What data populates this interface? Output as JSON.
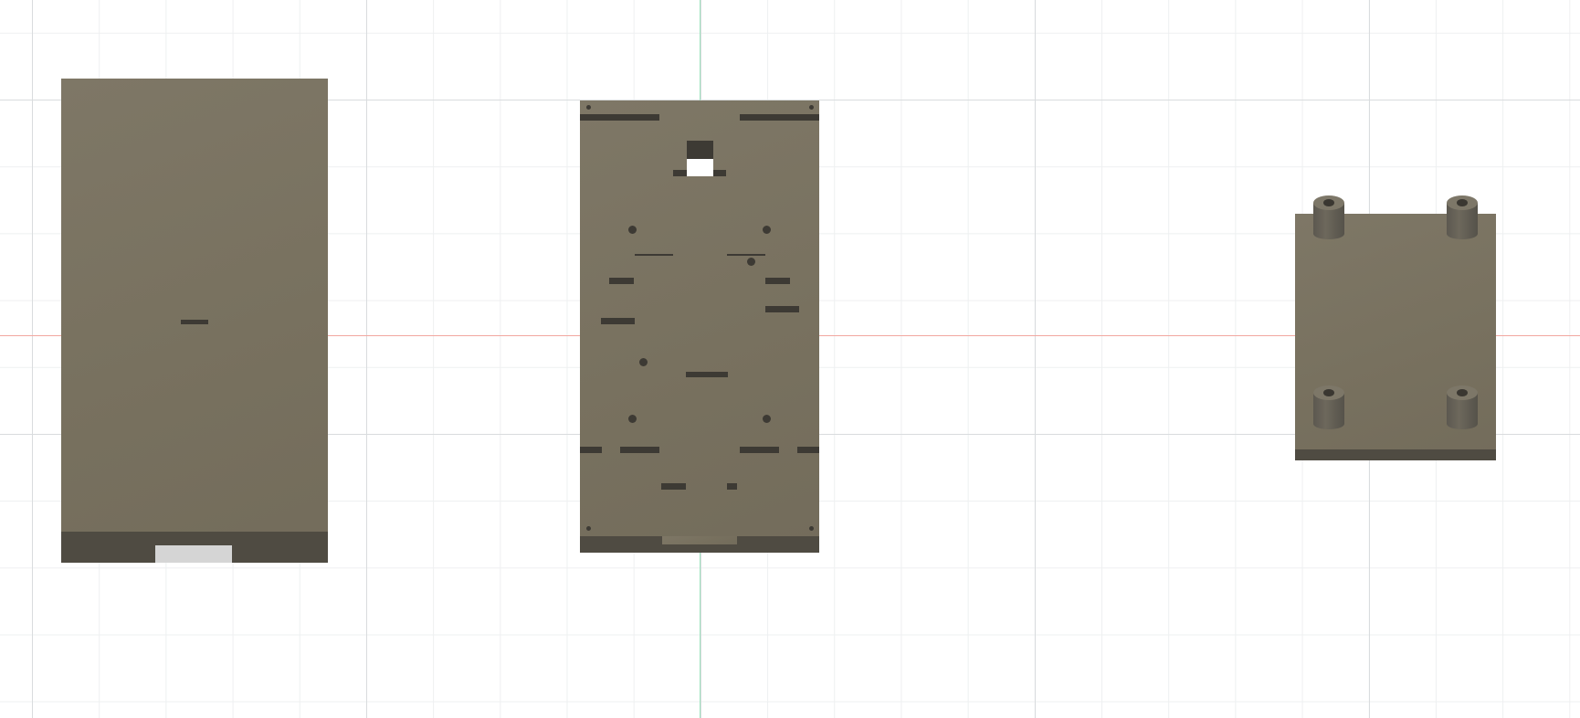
{
  "viewport": {
    "background": "#ffffff",
    "grid_major_color": "#d9dcde",
    "grid_minor_color": "#eef0f1",
    "x_axis_color": "#f2a7a0",
    "y_axis_color": "#9fe3bf"
  },
  "model": {
    "body_color": "#7a7362",
    "edge_color": "#4f4b42",
    "part_count": 3
  }
}
